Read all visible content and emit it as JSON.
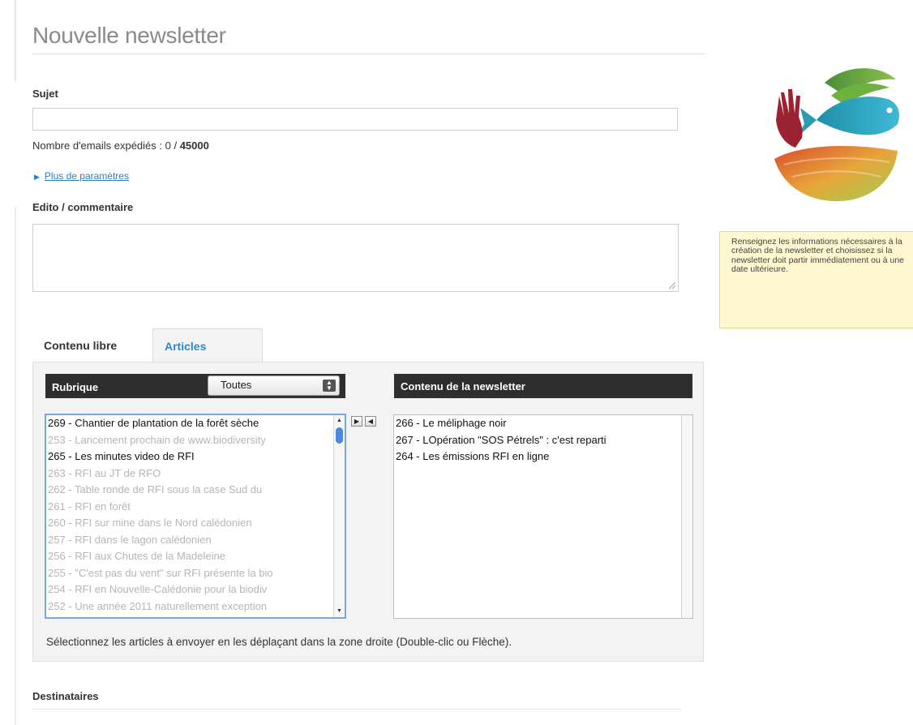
{
  "page": {
    "title": "Nouvelle newsletter"
  },
  "form": {
    "subject_label": "Sujet",
    "subject_value": "",
    "email_count_prefix": "Nombre d'emails expédiés : 0 / ",
    "email_count_max": "45000",
    "more_params_label": "Plus de paramètres",
    "edito_label": "Edito / commentaire",
    "edito_value": ""
  },
  "tabs": [
    {
      "label": "Contenu libre",
      "active": false
    },
    {
      "label": "Articles",
      "active": true
    }
  ],
  "articles_panel": {
    "rubrique_label": "Rubrique",
    "rubrique_selected": "Toutes",
    "contenu_label": "Contenu de la newsletter",
    "available_articles": [
      {
        "label": "269 - Chantier de plantation de la forêt sèche",
        "active": true
      },
      {
        "label": "253 - Lancement prochain de www.biodiversity",
        "active": false
      },
      {
        "label": "265 - Les minutes video de RFI",
        "active": true
      },
      {
        "label": "263 - RFI au JT de RFO",
        "active": false
      },
      {
        "label": "262 - Table ronde de RFI sous la case Sud du",
        "active": false
      },
      {
        "label": "261 - RFI en forêt",
        "active": false
      },
      {
        "label": "260 - RFI sur mine dans le Nord calédonien",
        "active": false
      },
      {
        "label": "257 - RFI dans le lagon calédonien",
        "active": false
      },
      {
        "label": "256 - RFI aux Chutes de la Madeleine",
        "active": false
      },
      {
        "label": "255 - \"C'est pas du vent\" sur RFI présente la bio",
        "active": false
      },
      {
        "label": "254 - RFI en Nouvelle-Calédonie pour la biodiv",
        "active": false
      },
      {
        "label": "252 - Une année 2011 naturellement exception",
        "active": false
      }
    ],
    "selected_articles": [
      "266 - Le méliphage noir",
      "267 - LOpération \"SOS Pétrels\" : c'est reparti",
      "264 - Les émissions RFI en ligne"
    ],
    "help_text": "Sélectionnez les articles à envoyer en les déplaçant dans la zone droite (Double-clic ou Flèche)."
  },
  "recipients": {
    "label": "Destinataires"
  },
  "sidebar": {
    "note": "Renseignez les informations nécessaires à la création de la newsletter et choisissez si la newsletter doit partir immédiatement ou à une date ultérieure."
  },
  "icons": {
    "move_right": "arrow-right-icon",
    "move_left": "arrow-left-icon",
    "expand": "triangle-right-icon",
    "logo": "logo-hand-fish-leaf"
  },
  "colors": {
    "link": "#2a7fc0",
    "tab_active": "#2a8ac8",
    "header_dark": "#2e2e2e",
    "note_bg": "#fff7cf",
    "inactive_text": "#b5b5b5"
  }
}
